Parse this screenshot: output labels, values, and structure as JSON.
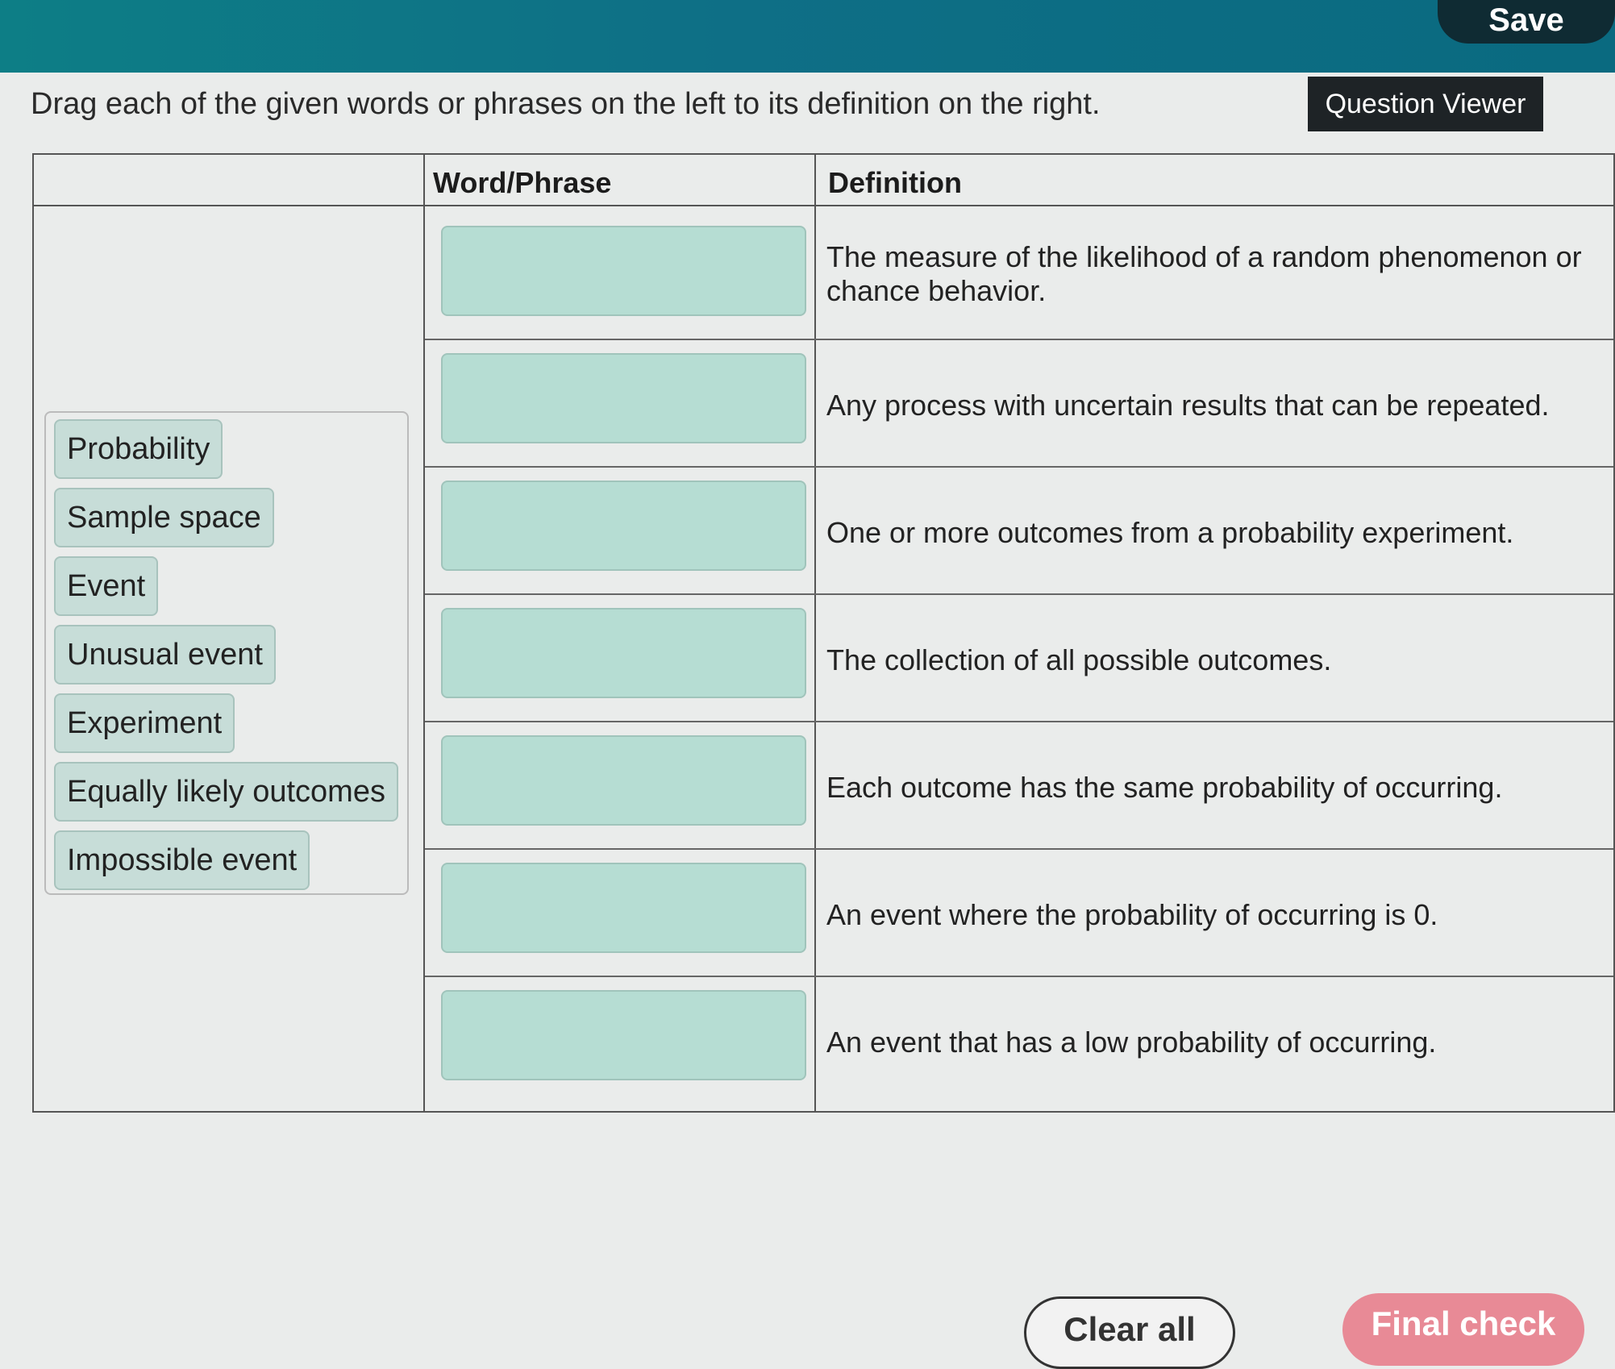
{
  "header": {
    "save_label": "Save"
  },
  "instruction": "Drag each of the given words or phrases on the left to its definition on the right.",
  "question_viewer_label": "Question Viewer",
  "table": {
    "col_word": "Word/Phrase",
    "col_definition": "Definition",
    "definitions": [
      "The measure of the likelihood of a random phenomenon or chance behavior.",
      "Any process with uncertain results that can be repeated.",
      "One or more outcomes from a probability experiment.",
      "The collection of all possible outcomes.",
      "Each outcome has the same probability of occurring.",
      "An event where the probability of occurring is 0.",
      "An event that has a low probability of occurring."
    ]
  },
  "word_bank": [
    "Probability",
    "Sample space",
    "Event",
    "Unusual event",
    "Experiment",
    "Equally likely outcomes",
    "Impossible event"
  ],
  "footer": {
    "clear_label": "Clear all",
    "check_label": "Final check"
  },
  "colors": {
    "topbar": "#0d7e86",
    "drop_zone": "#b6ddd3",
    "chip": "#c7ddd8",
    "final_check": "#e88a96"
  }
}
